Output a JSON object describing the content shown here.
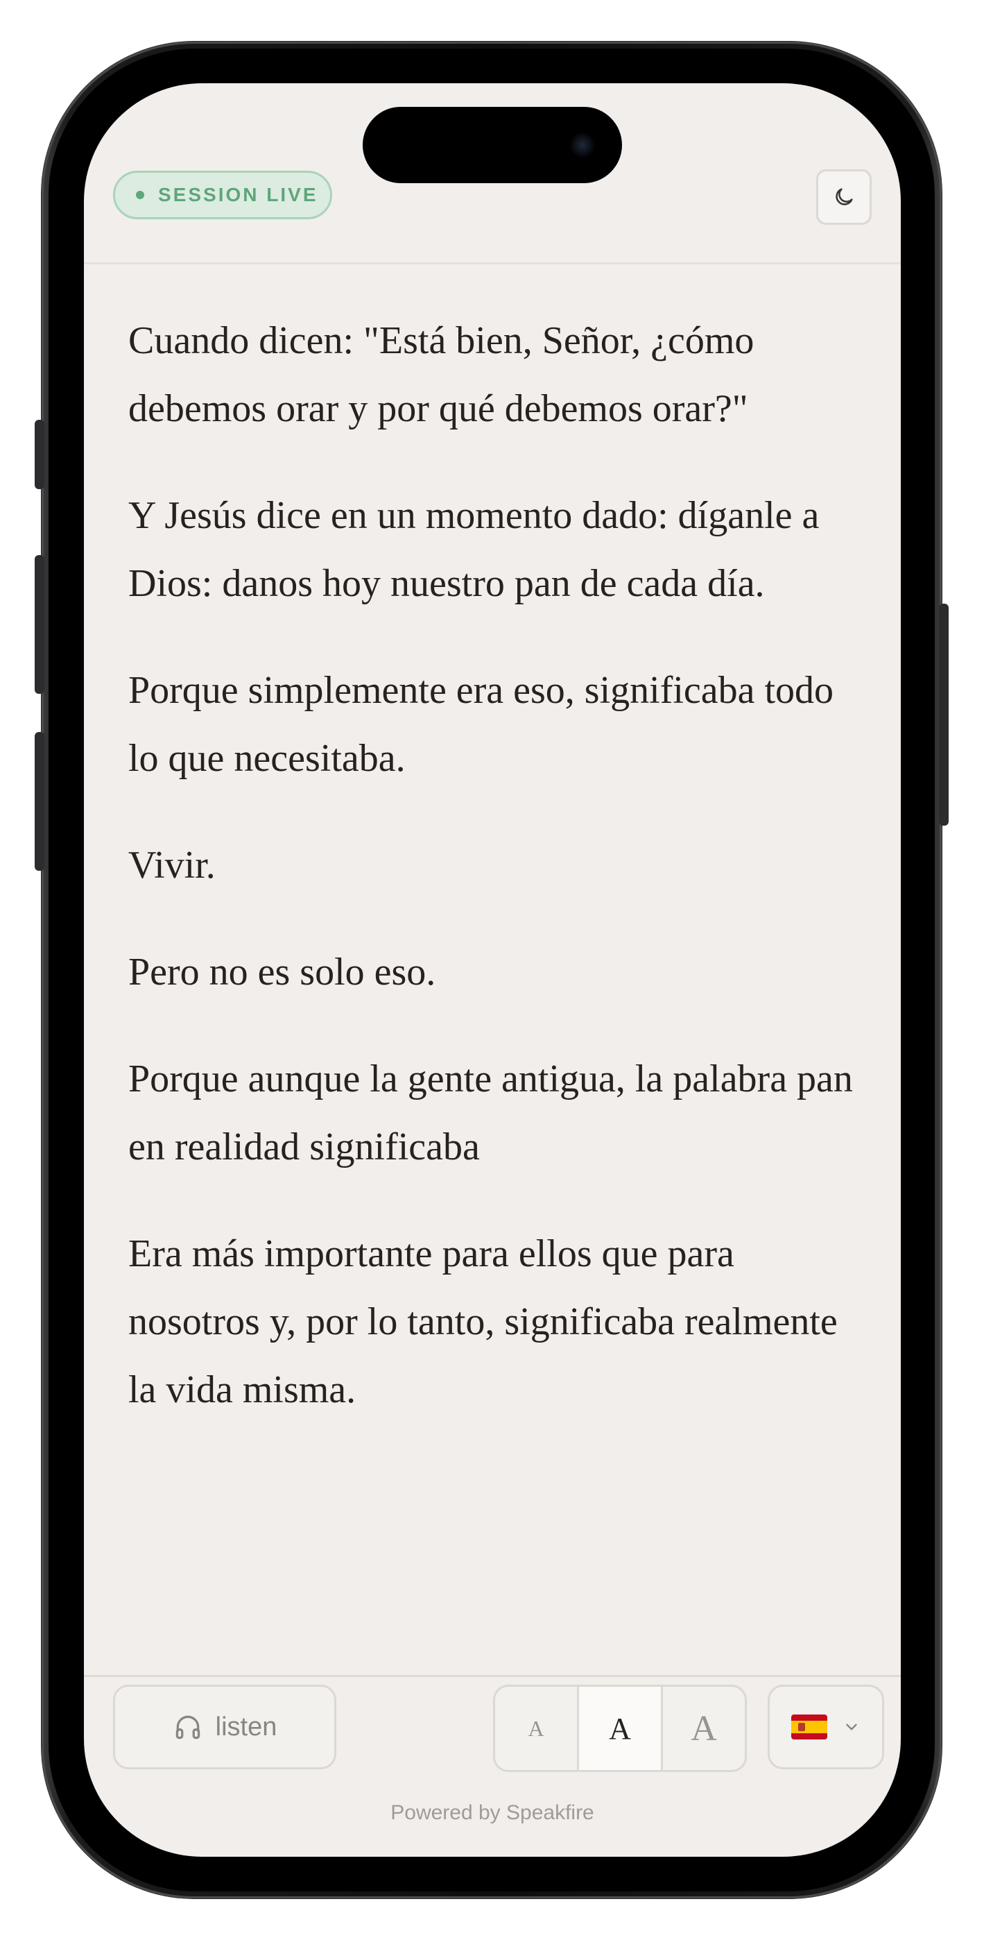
{
  "header": {
    "status_badge": "SESSION LIVE",
    "theme_toggle_icon": "moon-icon"
  },
  "transcript": {
    "paragraphs": [
      "Cuando dicen: \"Está bien, Señor, ¿cómo debemos orar y por qué debemos orar?\"",
      "Y Jesús dice en un momento dado: díganle a Dios: danos hoy nuestro pan de cada día.",
      "Porque simplemente era eso, significaba todo lo que necesitaba.",
      "Vivir.",
      "Pero no es solo eso.",
      "Porque aunque la gente antigua, la palabra pan en realidad significaba",
      "Era más importante para ellos que para nosotros y, por lo tanto, significaba realmente la vida misma."
    ]
  },
  "footer": {
    "listen_label": "listen",
    "listen_icon": "headphones-icon",
    "text_size_options": [
      "A",
      "A",
      "A"
    ],
    "text_size_selected": "medium",
    "language_icon": "spain-flag-icon",
    "powered_by": "Powered by Speakfire"
  },
  "colors": {
    "background": "#f1eeeb",
    "live_green": "#5fa67a",
    "text": "#26221e"
  }
}
